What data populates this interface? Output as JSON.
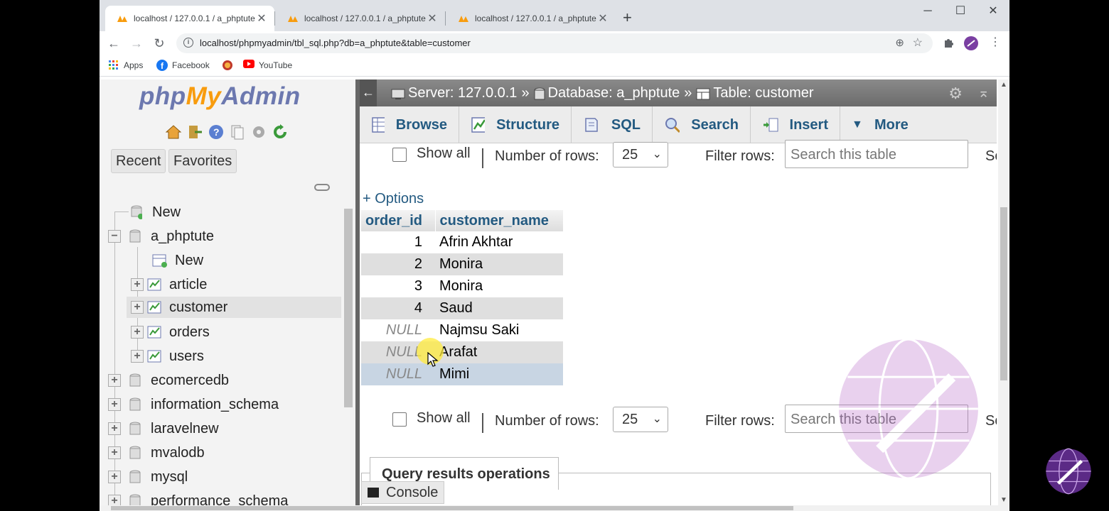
{
  "browser": {
    "tabs": [
      {
        "title": "localhost / 127.0.0.1 / a_phptute",
        "active": true
      },
      {
        "title": "localhost / 127.0.0.1 / a_phptute",
        "active": false
      },
      {
        "title": "localhost / 127.0.0.1 / a_phptute",
        "active": false
      }
    ],
    "new_tab_glyph": "+",
    "window_controls": {
      "minimize": "─",
      "maximize": "☐",
      "close": "✕"
    },
    "url": "localhost/phpmyadmin/tbl_sql.php?db=a_phptute&table=customer",
    "bookmarks": [
      {
        "label": "Apps",
        "icon": "apps-grid-icon"
      },
      {
        "label": "Facebook",
        "icon": "facebook-icon"
      },
      {
        "label": "",
        "icon": "shield-icon"
      },
      {
        "label": "YouTube",
        "icon": "youtube-icon"
      }
    ]
  },
  "nav": {
    "logo": {
      "php": "php",
      "my": "My",
      "admin": "Admin"
    },
    "tabs": {
      "recent": "Recent",
      "favorites": "Favorites"
    },
    "tree": {
      "new_root": "New",
      "current_db": "a_phptute",
      "db_new": "New",
      "tables": [
        "article",
        "customer",
        "orders",
        "users"
      ],
      "selected_table": "customer",
      "other_dbs": [
        "ecomercedb",
        "information_schema",
        "laravelnew",
        "mvalodb",
        "mysql",
        "performance_schema"
      ]
    }
  },
  "main": {
    "breadcrumb": {
      "back": "←",
      "server": "Server: 127.0.0.1",
      "sep1": "»",
      "database": "Database: a_phptute",
      "sep2": "»",
      "table": "Table: customer"
    },
    "menu": {
      "browse": "Browse",
      "structure": "Structure",
      "sql": "SQL",
      "search": "Search",
      "insert": "Insert",
      "more": "More"
    },
    "navigation": {
      "show_all": "Show all",
      "rows_label": "Number of rows:",
      "rows_value": "25",
      "filter_label": "Filter rows:",
      "filter_placeholder": "Search this table",
      "sort_label": "Sor"
    },
    "options_link": "+ Options",
    "results": {
      "columns": [
        "order_id",
        "customer_name"
      ],
      "rows": [
        {
          "order_id": "1",
          "customer_name": "Afrin Akhtar"
        },
        {
          "order_id": "2",
          "customer_name": "Monira"
        },
        {
          "order_id": "3",
          "customer_name": "Monira"
        },
        {
          "order_id": "4",
          "customer_name": "Saud"
        },
        {
          "order_id": "NULL",
          "customer_name": "Najmsu Saki"
        },
        {
          "order_id": "NULL",
          "customer_name": "Arafat"
        },
        {
          "order_id": "NULL",
          "customer_name": "Mimi"
        }
      ]
    },
    "query_results_operations": "Query results operations",
    "console": "Console"
  },
  "colors": {
    "pma_link": "#235a81",
    "logo_orange": "#f89c0e",
    "logo_blue": "#6c78af",
    "watermark": "#b25dc6"
  }
}
